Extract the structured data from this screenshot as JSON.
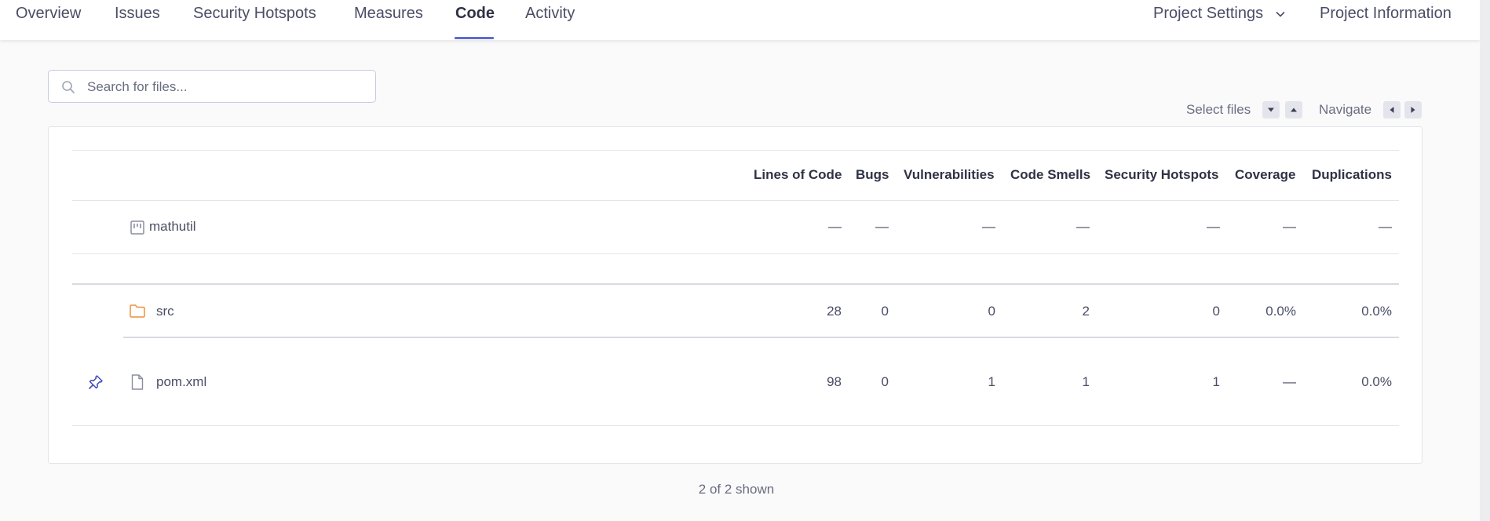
{
  "nav": {
    "tabs": [
      {
        "label": "Overview"
      },
      {
        "label": "Issues"
      },
      {
        "label": "Security Hotspots"
      },
      {
        "label": "Measures"
      },
      {
        "label": "Code"
      },
      {
        "label": "Activity"
      }
    ],
    "active_tab": "Code",
    "project_settings": "Project Settings",
    "project_information": "Project Information"
  },
  "search": {
    "placeholder": "Search for files...",
    "value": ""
  },
  "shortcuts": {
    "select_files": "Select files",
    "navigate": "Navigate"
  },
  "table": {
    "columns": [
      "Lines of Code",
      "Bugs",
      "Vulnerabilities",
      "Code Smells",
      "Security Hotspots",
      "Coverage",
      "Duplications"
    ],
    "root": {
      "name": "mathutil",
      "icon": "project-icon",
      "values": [
        "—",
        "—",
        "—",
        "—",
        "—",
        "—",
        "—"
      ]
    },
    "rows": [
      {
        "name": "src",
        "icon": "folder-icon",
        "values": [
          "28",
          "0",
          "0",
          "2",
          "0",
          "0.0%",
          "0.0%"
        ]
      },
      {
        "name": "pom.xml",
        "icon": "file-icon",
        "pinned": true,
        "values": [
          "98",
          "0",
          "1",
          "1",
          "1",
          "—",
          "0.0%"
        ]
      }
    ]
  },
  "footer": {
    "count": "2 of 2 shown"
  },
  "colors": {
    "accent": "#5d6cd0",
    "folder": "#ef8f3f",
    "pin": "#3f4ab8",
    "text": "#2f3245"
  }
}
